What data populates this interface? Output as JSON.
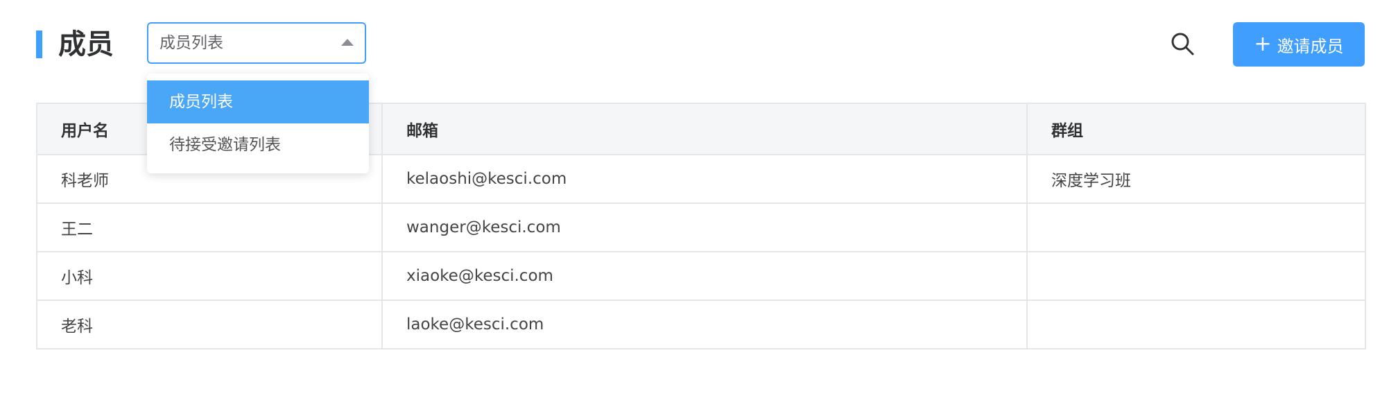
{
  "header": {
    "title": "成员",
    "select_value": "成员列表",
    "invite_label": "邀请成员",
    "plus_glyph": "+"
  },
  "dropdown": {
    "options": [
      {
        "label": "成员列表",
        "selected": true
      },
      {
        "label": "待接受邀请列表",
        "selected": false
      }
    ]
  },
  "table": {
    "columns": [
      "用户名",
      "邮箱",
      "群组"
    ],
    "rows": [
      [
        "科老师",
        "kelaoshi@kesci.com",
        "深度学习班"
      ],
      [
        "王二",
        "wanger@kesci.com",
        ""
      ],
      [
        "小科",
        "xiaoke@kesci.com",
        ""
      ],
      [
        "老科",
        "laoke@kesci.com",
        ""
      ]
    ]
  },
  "icons": {
    "search": "search-icon",
    "arrow": "caret-up-icon",
    "plus": "plus-icon"
  },
  "colors": {
    "accent": "#409eff",
    "selected_option": "#4aa7f7",
    "header_bg": "#f5f6f8",
    "border": "#e4e6ea"
  }
}
